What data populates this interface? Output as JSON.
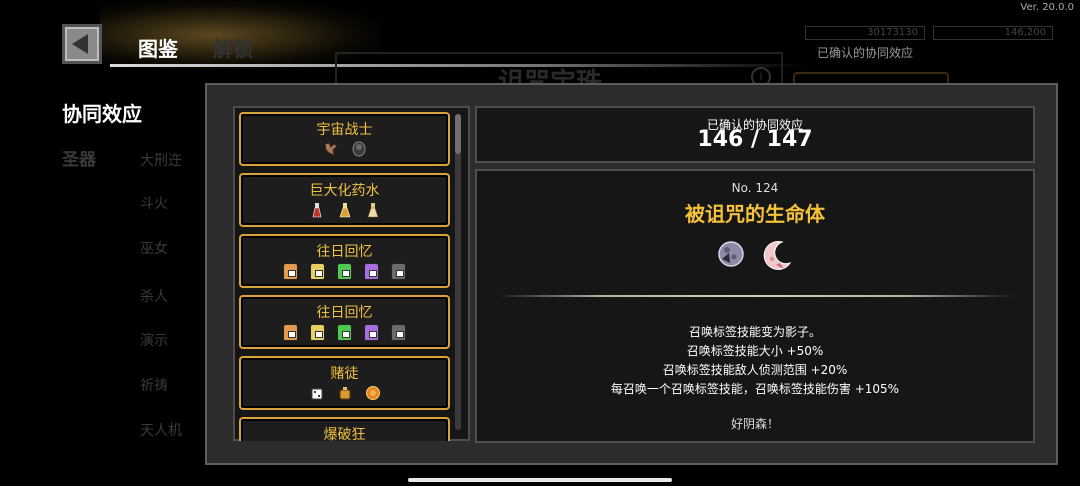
{
  "version": "Ver. 20.0.0",
  "header": {
    "title": "图鉴",
    "title_dim": "解锁",
    "stat1": "30173130",
    "stat2": "146,200",
    "bg_label": "已确认的协同效应",
    "ghost_title": "诅咒宝珠",
    "info": "i"
  },
  "nav": {
    "active": "协同效应",
    "second": "圣器",
    "sub_items": [
      "大刑迕",
      "斗火",
      "巫女",
      "杀人",
      "演示",
      "祈祷",
      "天人机"
    ]
  },
  "list": {
    "cards": [
      {
        "title": "宇宙战士",
        "icons": [
          "fist-icon",
          "boot-icon"
        ]
      },
      {
        "title": "巨大化药水",
        "icons": [
          "potion-red-icon",
          "potion-gold-icon",
          "flask-icon"
        ]
      },
      {
        "title": "往日回忆",
        "icons": [
          "bag-orange-icon",
          "bag-yellow-icon",
          "bag-green-icon",
          "bag-purple-icon",
          "bag-grey-icon"
        ]
      },
      {
        "title": "往日回忆",
        "icons": [
          "bag-orange-icon",
          "bag-yellow-icon",
          "bag-green-icon",
          "bag-purple-icon",
          "bag-grey-icon"
        ]
      },
      {
        "title": "赌徒",
        "icons": [
          "dice-icon",
          "coin-bag-icon",
          "coin-icon"
        ]
      },
      {
        "title": "爆破狂",
        "icons": []
      }
    ]
  },
  "count": {
    "label": "已确认的协同效应",
    "value": "146 / 147"
  },
  "detail": {
    "number": "No. 124",
    "name": "被诅咒的生命体",
    "icons": [
      "moon-orb-icon",
      "crescent-moon-icon"
    ],
    "effects": [
      "召唤标签技能变为影子。",
      "召唤标签技能大小 +50%",
      "召唤标签技能敌人侦测范围 +20%",
      "每召唤一个召唤标签技能，召唤标签技能伤害 +105%"
    ],
    "flavor": "好阴森！"
  },
  "colors": {
    "accent_gold": "#f4c13a",
    "card_border": "#d9a23c",
    "panel_bg": "#2c2c2c"
  }
}
